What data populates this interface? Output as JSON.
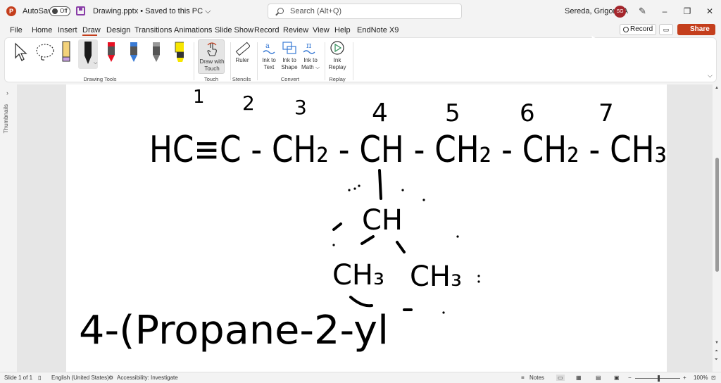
{
  "titlebar": {
    "app_icon": "powerpoint-icon",
    "autosave_label": "AutoSave",
    "autosave_state": "Off",
    "doc_title": "Drawing.pptx • Saved to this PC ⌵",
    "search_placeholder": "Search (Alt+Q)",
    "user_name": "Sereda, Grigoriy A",
    "user_initials": "SG",
    "minimize": "–",
    "restore": "❐",
    "close": "✕"
  },
  "menu": {
    "items": [
      "File",
      "Home",
      "Insert",
      "Draw",
      "Design",
      "Transitions",
      "Animations",
      "Slide Show",
      "Record",
      "Review",
      "View",
      "Help",
      "EndNote X9"
    ],
    "active": "Draw",
    "record_label": "Record",
    "share_label": "Share"
  },
  "ribbon": {
    "groups": {
      "drawing_tools": "Drawing Tools",
      "touch": "Touch",
      "stencils": "Stencils",
      "convert": "Convert",
      "replay": "Replay"
    },
    "buttons": {
      "draw_with_touch_1": "Draw with",
      "draw_with_touch_2": "Touch",
      "ruler": "Ruler",
      "ink_to_text_1": "Ink to",
      "ink_to_text_2": "Text",
      "ink_to_shape_1": "Ink to",
      "ink_to_shape_2": "Shape",
      "ink_to_math_1": "Ink to",
      "ink_to_math_2": "Math ⌵",
      "ink_replay_1": "Ink",
      "ink_replay_2": "Replay"
    },
    "pen_colors": [
      "#1a1a1a",
      "#e81123",
      "#3a7bd5",
      "#7a7a7a",
      "#f7e600"
    ]
  },
  "sidebar": {
    "label": "Thumbnails",
    "expand_icon": "chevron-right-icon"
  },
  "slide_ink": {
    "numbers": [
      "1",
      "2",
      "3",
      "4",
      "5",
      "6",
      "7"
    ],
    "line1": "HC≡C - CH₂ - CH - CH₂ - CH₂ - CH₃",
    "branch_ch": "CH",
    "branch_ch3_left": "CH₃",
    "branch_ch3_right": "CH₃",
    "name_line": "4-(Propane-2-yl"
  },
  "statusbar": {
    "slide_info": "Slide 1 of 1",
    "language": "English (United States)",
    "accessibility": "Accessibility: Investigate",
    "notes": "Notes",
    "zoom": "100%"
  }
}
